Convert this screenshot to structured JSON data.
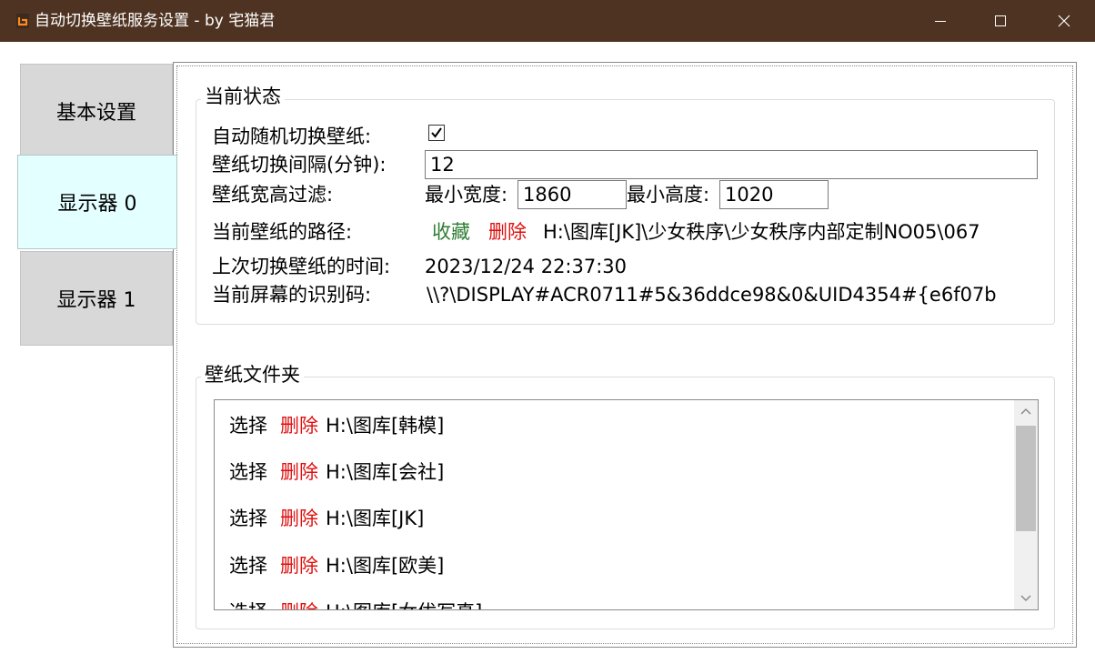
{
  "window": {
    "title": "自动切换壁纸服务设置 - by 宅猫君",
    "icon": "app-icon"
  },
  "tabs": [
    {
      "label": "基本设置",
      "active": false
    },
    {
      "label": "显示器 0",
      "active": true
    },
    {
      "label": "显示器 1",
      "active": false
    }
  ],
  "status": {
    "group_title": "当前状态",
    "auto_switch_label": "自动随机切换壁纸:",
    "auto_switch_checked": true,
    "interval_label": "壁纸切换间隔(分钟):",
    "interval_value": "12",
    "filter_label": "壁纸宽高过滤:",
    "min_width_label": "最小宽度:",
    "min_width_value": "1860",
    "min_height_label": "最小高度:",
    "min_height_value": "1020",
    "path_label": "当前壁纸的路径:",
    "favorite_link": "收藏",
    "delete_link": "删除",
    "path_value": "H:\\图库[JK]\\少女秩序\\少女秩序内部定制NO05\\067",
    "last_switch_label": "上次切换壁纸的时间:",
    "last_switch_value": "2023/12/24 22:37:30",
    "screen_id_label": "当前屏幕的识别码:",
    "screen_id_value": "\\\\?\\DISPLAY#ACR0711#5&36ddce98&0&UID4354#{e6f07b"
  },
  "folders": {
    "group_title": "壁纸文件夹",
    "select_label": "选择",
    "delete_label": "删除",
    "items": [
      {
        "path": "H:\\图库[韩模]"
      },
      {
        "path": "H:\\图库[会社]"
      },
      {
        "path": "H:\\图库[JK]"
      },
      {
        "path": "H:\\图库[欧美]"
      },
      {
        "path": "H:\\图库[女优写真]"
      }
    ]
  },
  "colors": {
    "titlebar": "#4f3322",
    "active_tab": "#e3ffff",
    "link_green": "#2f7d32",
    "link_red": "#e01010"
  }
}
